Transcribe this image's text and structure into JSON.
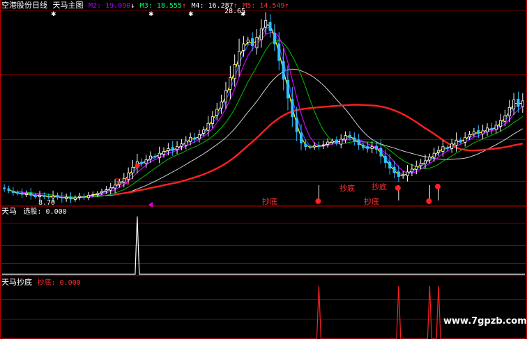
{
  "colors": {
    "background": "#000000",
    "grid": "#8b0000",
    "frame": "#c00000",
    "title_white": "#ffffff",
    "m2": "#b000ff",
    "m3": "#00ff66",
    "m4": "#ffffff",
    "m5": "#ff2a2a",
    "candle_up": "#ffffff",
    "candle_down": "#30c0ff",
    "yellow_ma": "#ffff00",
    "blue_ma": "#3050ff",
    "purple_ma": "#d000ff",
    "green_ma": "#00c000",
    "white_ma": "#d0d0d0",
    "red_ma": "#ff2020",
    "buy_dot": "#ff2020",
    "buy_text": "#ff3030",
    "xuangu_text": "#ffffff",
    "chaodi_value": "#ff3030"
  },
  "main_panel": {
    "title_a": "空港股份日线",
    "title_b": "天马主图",
    "m2_label": "M2: 19.090",
    "m2_arrow": "↓",
    "m3_label": "M3: 18.555",
    "m3_arrow": "↑",
    "m4_label": "M4: 16.287",
    "m4_arrow": "↑",
    "m5_label": "M5: 14.549",
    "m5_arrow": "↑",
    "high_price": "28.65",
    "low_price": "8.70",
    "signal_tianma": "天马",
    "signal_chaodi_1": "抄底",
    "signal_chaodi_2": "抄底",
    "signal_chaodi_3": "抄底",
    "signal_chaodi_4": "抄底"
  },
  "panel_xuangu": {
    "label": "天马",
    "value_label": "选股: 0.000"
  },
  "panel_chaodi": {
    "label": "天马抄底",
    "value_label": "抄底: 0.000"
  },
  "watermark": "www.7gpzb.com",
  "chart_data": {
    "type": "candlestick",
    "price_range": [
      8.7,
      28.65
    ],
    "closes": [
      10.1,
      9.9,
      9.7,
      9.6,
      9.5,
      9.6,
      9.4,
      9.3,
      9.4,
      9.3,
      9.2,
      9.3,
      9.2,
      9.1,
      9.2,
      9.0,
      9.1,
      9.3,
      9.2,
      9.4,
      9.5,
      9.6,
      9.8,
      10.0,
      10.2,
      10.5,
      10.8,
      11.2,
      11.8,
      12.4,
      13.0,
      12.8,
      13.2,
      13.6,
      13.5,
      13.9,
      14.1,
      14.4,
      14.2,
      14.6,
      14.9,
      15.2,
      15.6,
      15.4,
      15.9,
      16.4,
      17.1,
      17.8,
      18.6,
      19.4,
      20.6,
      22.0,
      23.4,
      24.8,
      25.6,
      26.0,
      25.4,
      26.3,
      27.2,
      28.1,
      27.0,
      25.6,
      23.8,
      21.8,
      19.8,
      17.8,
      16.2,
      15.0,
      14.6,
      14.5,
      14.7,
      14.6,
      14.8,
      15.1,
      15.2,
      15.0,
      15.4,
      15.8,
      15.6,
      15.2,
      14.8,
      14.5,
      14.4,
      14.6,
      14.3,
      13.6,
      12.9,
      12.3,
      11.8,
      11.4,
      11.6,
      11.9,
      12.2,
      12.5,
      12.8,
      13.1,
      13.5,
      13.9,
      14.2,
      14.6,
      14.4,
      14.9,
      15.3,
      15.1,
      15.6,
      15.9,
      16.2,
      16.0,
      16.3,
      16.6,
      16.4,
      16.9,
      17.4,
      17.9,
      18.8,
      19.6,
      18.9,
      19.5
    ],
    "xuangu_signal_index": 30,
    "chaodi_signal_indices": [
      71,
      89,
      96,
      98
    ],
    "xuangu_value": 0.0,
    "chaodi_value": 0.0
  }
}
